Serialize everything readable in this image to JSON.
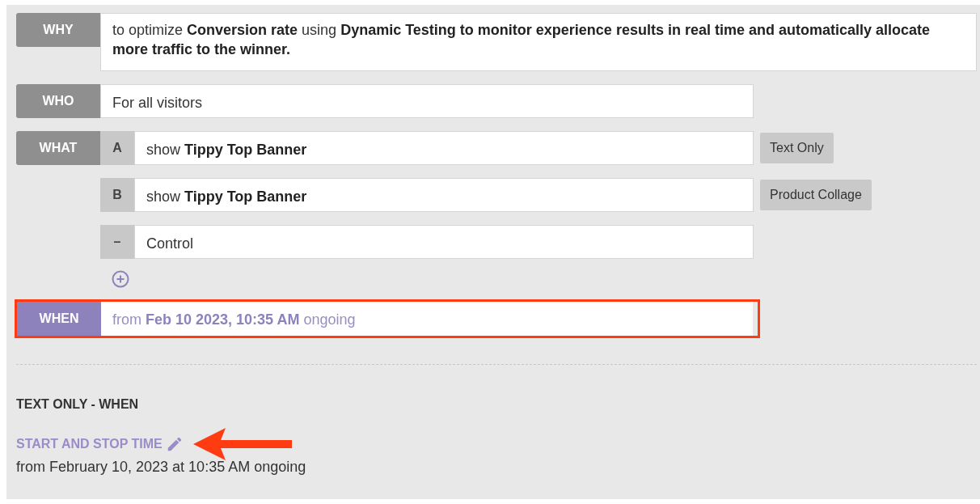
{
  "why": {
    "label": "WHY",
    "text": "to optimize **Conversion rate** using **Dynamic Testing to monitor experience results in real time and automatically allocate more traffic to the winner.**"
  },
  "who": {
    "label": "WHO",
    "text": "For all visitors"
  },
  "what": {
    "label": "WHAT",
    "variants": [
      {
        "letter": "A",
        "text": "show **Tippy Top Banner**",
        "tag": "Text Only"
      },
      {
        "letter": "B",
        "text": "show **Tippy Top Banner**",
        "tag": "Product Collage"
      },
      {
        "letter": "–",
        "text": "Control"
      }
    ]
  },
  "when": {
    "label": "WHEN",
    "text": "from **Feb 10 2023, 10:35 AM** ongoing",
    "highlighted": true
  },
  "detail": {
    "heading": "TEXT ONLY - WHEN",
    "link": "START AND STOP TIME",
    "pointer_arrow": true,
    "value": "from February 10, 2023 at 10:35 AM ongoing"
  }
}
